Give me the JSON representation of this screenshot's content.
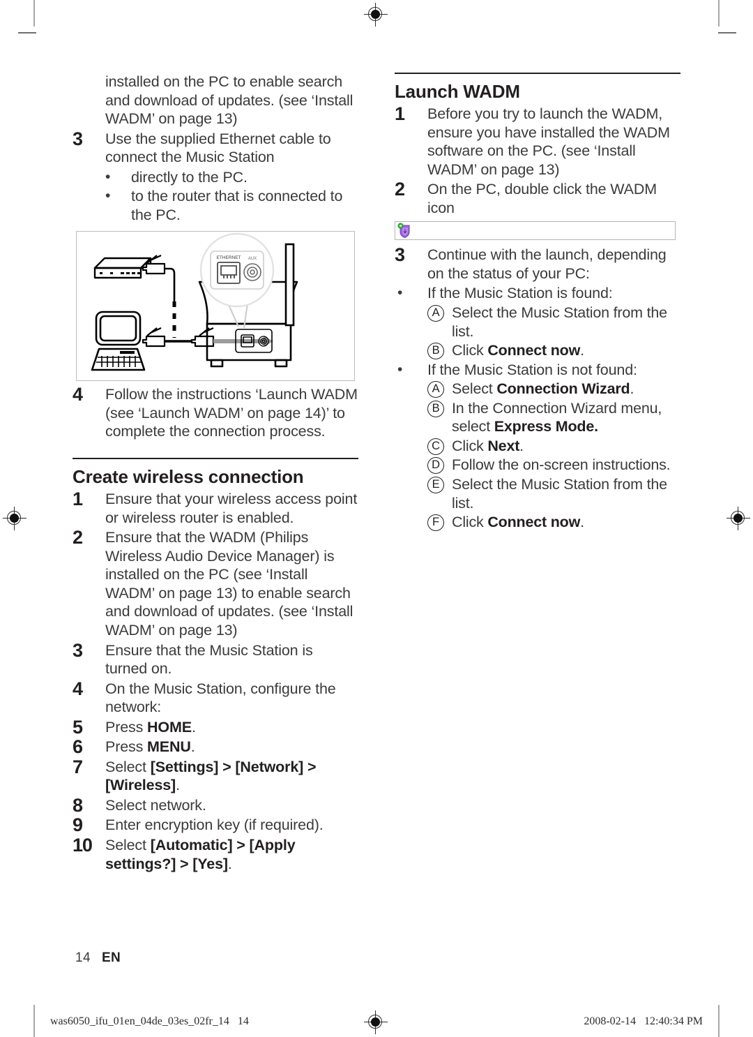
{
  "document": {
    "page_number": "14",
    "language_code": "EN",
    "slug_left": "was6050_ifu_01en_04de_03es_02fr_14   14",
    "slug_right": "2008-02-14   12:40:34 PM"
  },
  "left_column": {
    "continued_paragraph": "installed on the PC to enable search and download of updates. (see ‘Install WADM’ on page 13)",
    "wired_steps": [
      {
        "num": "3",
        "text": "Use the supplied Ethernet cable to connect the Music Station",
        "bullets": [
          "directly to the PC.",
          "to the router that is connected to the PC."
        ]
      },
      {
        "num": "4",
        "text_parts": {
          "plain1": "Follow the instructions ‘Launch WADM (see ‘Launch WADM’ on page 14)’ to complete the connection process."
        }
      }
    ],
    "figure": {
      "caption_labels": {
        "ethernet_port": "ETHERNET",
        "aux_port": "AUX"
      },
      "devices": [
        "router",
        "pc",
        "music-station"
      ]
    },
    "wireless_heading": "Create wireless connection",
    "wireless_steps": [
      {
        "num": "1",
        "text": "Ensure that your wireless access point or wireless router is enabled."
      },
      {
        "num": "2",
        "text": "Ensure that the WADM (Philips Wireless Audio Device Manager) is installed on the PC (see ‘Install WADM’ on page 13) to enable search and download of updates. (see ‘Install WADM’ on page 13)"
      },
      {
        "num": "3",
        "text": "Ensure that the Music Station is turned on."
      },
      {
        "num": "4",
        "text": "On the Music Station, configure the network:"
      },
      {
        "num": "5",
        "prefix": "Press ",
        "bold": "HOME",
        "suffix": "."
      },
      {
        "num": "6",
        "prefix": "Press ",
        "bold": "MENU",
        "suffix": "."
      },
      {
        "num": "7",
        "prefix": "Select ",
        "bold": "[Settings] > [Network] > [Wireless]",
        "suffix": "."
      },
      {
        "num": "8",
        "text": "Select network."
      },
      {
        "num": "9",
        "text": "Enter encryption key (if required)."
      },
      {
        "num": "10",
        "prefix": "Select ",
        "bold": "[Automatic] > [Apply settings?] > [Yes]",
        "suffix": "."
      }
    ]
  },
  "right_column": {
    "heading": "Launch WADM",
    "steps": [
      {
        "num": "1",
        "text": "Before you try to launch the WADM, ensure you have installed the WADM software on the PC. (see ‘Install WADM’ on page 13)"
      },
      {
        "num": "2",
        "text": "On the PC, double click the WADM icon"
      },
      {
        "num": "3",
        "text": "Continue with the launch, depending on the status of your PC:"
      }
    ],
    "wadm_icon_name": "wadm-shield-icon",
    "found_case": {
      "bullet": "If the Music Station is found:",
      "items": [
        {
          "letter": "A",
          "prefix": "Select the Music Station from the list.",
          "bold": "",
          "suffix": ""
        },
        {
          "letter": "B",
          "prefix": "Click ",
          "bold": "Connect now",
          "suffix": "."
        }
      ]
    },
    "not_found_case": {
      "bullet": "If the Music Station is not found:",
      "items": [
        {
          "letter": "A",
          "prefix": "Select ",
          "bold": "Connection Wizard",
          "suffix": "."
        },
        {
          "letter": "B",
          "prefix": "In the Connection Wizard menu, select ",
          "bold": "Express Mode.",
          "suffix": ""
        },
        {
          "letter": "C",
          "prefix": "Click ",
          "bold": "Next",
          "suffix": "."
        },
        {
          "letter": "D",
          "prefix": "Follow the on-screen instructions.",
          "bold": "",
          "suffix": ""
        },
        {
          "letter": "E",
          "prefix": "Select the Music Station from the list.",
          "bold": "",
          "suffix": ""
        },
        {
          "letter": "F",
          "prefix": "Click ",
          "bold": "Connect now",
          "suffix": "."
        }
      ]
    }
  },
  "colors": {
    "text": "#3b3b3b",
    "heading": "#231f20",
    "rule": "#231f20",
    "figure_border": "#bdbdbd",
    "icon_purple": "#8e5fd3",
    "icon_green": "#35c23a"
  }
}
